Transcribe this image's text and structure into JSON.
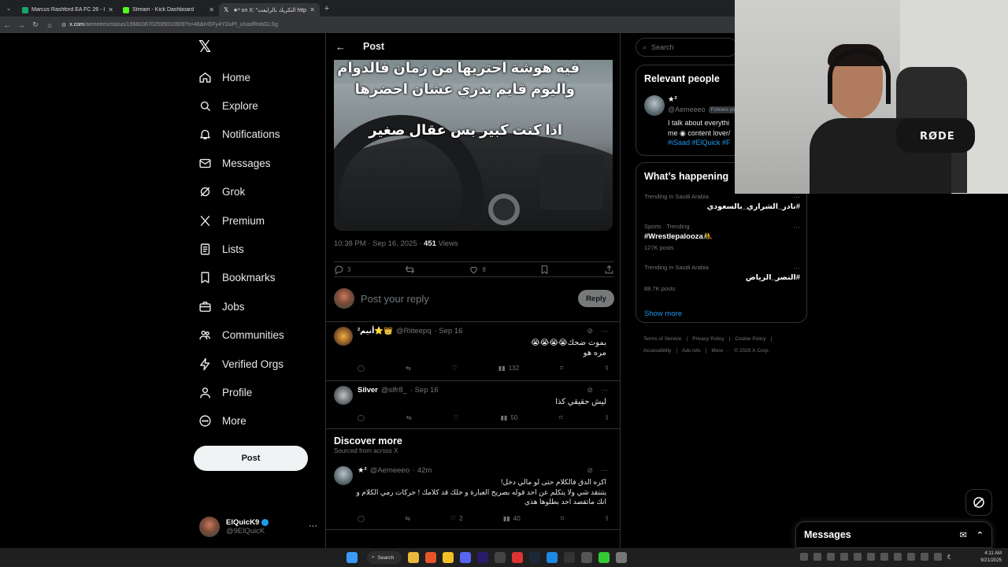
{
  "browser": {
    "tabs": [
      {
        "title": "Marcus Rashford EA FC 26 - 8x",
        "color": "#1ca36b"
      },
      {
        "title": "Stream - Kick Dashboard",
        "color": "#53fc18"
      },
      {
        "title": "★² on X: \"التكريك بالرايفت https:",
        "color": "#ffffff"
      }
    ],
    "active_tab": 2,
    "url_host": "x.com",
    "url_path": "/aemeeeo/status/1968036702595010809?s=46&t=EFy4YDuPl_xXasfRobGLSg"
  },
  "nav": {
    "items": [
      {
        "label": "Home",
        "icon": "home-icon"
      },
      {
        "label": "Explore",
        "icon": "search-icon"
      },
      {
        "label": "Notifications",
        "icon": "bell-icon"
      },
      {
        "label": "Messages",
        "icon": "mail-icon"
      },
      {
        "label": "Grok",
        "icon": "grok-icon"
      },
      {
        "label": "Premium",
        "icon": "x-logo-icon"
      },
      {
        "label": "Lists",
        "icon": "list-icon"
      },
      {
        "label": "Bookmarks",
        "icon": "bookmark-icon"
      },
      {
        "label": "Jobs",
        "icon": "briefcase-icon"
      },
      {
        "label": "Communities",
        "icon": "people-icon"
      },
      {
        "label": "Verified Orgs",
        "icon": "lightning-icon"
      },
      {
        "label": "Profile",
        "icon": "person-icon"
      },
      {
        "label": "More",
        "icon": "more-circle-icon"
      }
    ],
    "post_label": "Post",
    "account": {
      "name": "ElQuicK9",
      "handle": "@9ElQuicK"
    }
  },
  "post": {
    "header_title": "Post",
    "overlay_lines": [
      "فيه هوشة احتريها من زمان فالدوام",
      "واليوم قايم بدري عشان احضرها",
      "اذا كنت كبير بس عقال صغير"
    ],
    "timestamp": "10:38 PM · Sep 16, 2025 · ",
    "views": "451",
    "views_label": " Views",
    "replies": "3",
    "likes": "8",
    "reply_placeholder": "Post your reply",
    "reply_button": "Reply"
  },
  "replies": [
    {
      "name": "²أنيم⭐️👑",
      "handle": "@Riiteepq",
      "date": "· Sep 16",
      "body": "بموت ضحك😭😭😭😭\nمره هو",
      "views": "132",
      "avatar_color": "#8a5a2a"
    },
    {
      "name": "Silver",
      "handle": "@slfr8_",
      "date": "· Sep 16",
      "body": "ليش حقيقي كذا",
      "views": "50",
      "avatar_color": "#6b6f72"
    }
  ],
  "discover": {
    "title": "Discover more",
    "subtitle": "Sourced from across X",
    "post": {
      "name": "★²",
      "handle": "@Aemeeeo",
      "date": "· 42m",
      "body": "اكره الدق فالكلام حتى لو مالي دخل!\nيتنتقد شي ولا يتكلم عن احد قوله بصريح العبارة و خلك قد كلامك ! حركات رمي الكلام و\nانك ماتقصد احد بطلوها هذي",
      "likes": "2",
      "views": "40"
    }
  },
  "right": {
    "search_placeholder": "Search",
    "relevant_title": "Relevant people",
    "relevant": {
      "name": "★²",
      "handle": "@Aemeeeo",
      "badge": "Follows you",
      "bio_line1": "I talk about everythi",
      "bio_line2": "me ◉ content lover/",
      "bio_tags": "#iSaad #ElQuick #F"
    },
    "happening_title": "What’s happening",
    "trends": [
      {
        "context": "Trending in Saudi Arabia",
        "topic": "#نادر_الشراري_بالسعودي",
        "count": "",
        "rtl": true
      },
      {
        "context": "Sports · Trending",
        "topic": "#Wrestlepalooza🤼",
        "count": "127K posts",
        "rtl": false
      },
      {
        "context": "Trending in Saudi Arabia",
        "topic": "#النصر_الرياض",
        "count": "88.7K posts",
        "rtl": true
      }
    ],
    "show_more": "Show more",
    "footer": [
      "Terms of Service",
      "|",
      "Privacy Policy",
      "|",
      "Cookie Policy",
      "|",
      "Accessibility",
      "|",
      "Ads info",
      "|",
      "More ···",
      "© 2025 X Corp."
    ]
  },
  "webcam": {
    "mic_brand": "RØDE"
  },
  "messages_drawer": {
    "label": "Messages"
  },
  "taskbar": {
    "search_label": "Search",
    "time": "4:11 AM",
    "date": "9/21/2025",
    "lang": "ع"
  },
  "colors": {
    "accent": "#1d9bf0",
    "background": "#000000",
    "border": "#2f3336",
    "muted": "#71767b"
  }
}
